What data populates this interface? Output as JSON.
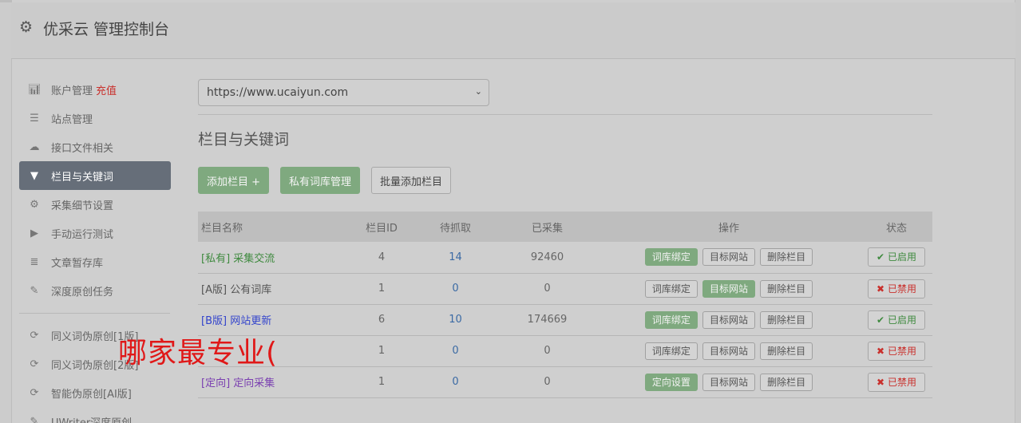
{
  "header": {
    "title": "优采云 管理控制台"
  },
  "sidebar": {
    "items": [
      {
        "label": "账户管理",
        "extra": "充值"
      },
      {
        "label": "站点管理"
      },
      {
        "label": "接口文件相关"
      },
      {
        "label": "栏目与关键词"
      },
      {
        "label": "采集细节设置"
      },
      {
        "label": "手动运行测试"
      },
      {
        "label": "文章暂存库"
      },
      {
        "label": "深度原创任务"
      }
    ],
    "items2": [
      {
        "label": "同义词伪原创[1版]"
      },
      {
        "label": "同义词伪原创[2版]"
      },
      {
        "label": "智能伪原创[AI版]"
      },
      {
        "label": "UWriter深度原创"
      }
    ]
  },
  "site_select": {
    "value": "https://www.ucaiyun.com"
  },
  "page_title": "栏目与关键词",
  "toolbar": {
    "add_label": "添加栏目 +",
    "private_label": "私有词库管理",
    "batch_label": "批量添加栏目"
  },
  "table": {
    "headers": [
      "栏目名称",
      "栏目ID",
      "待抓取",
      "已采集",
      "操作",
      "状态"
    ],
    "rows": [
      {
        "tag": "[私有]",
        "name": "采集交流",
        "id": "4",
        "wait": "14",
        "got": "92460",
        "op1": "词库绑定",
        "op2": "目标网站",
        "op3": "删除栏目",
        "status": "已启用"
      },
      {
        "tag": "[A版]",
        "name": "公有词库",
        "id": "1",
        "wait": "0",
        "got": "0",
        "op1": "词库绑定",
        "op2": "目标网站",
        "op3": "删除栏目",
        "status": "已禁用"
      },
      {
        "tag": "[B版]",
        "name": "网站更新",
        "id": "6",
        "wait": "10",
        "got": "174669",
        "op1": "词库绑定",
        "op2": "目标网站",
        "op3": "删除栏目",
        "status": "已启用"
      },
      {
        "tag": "",
        "name": "",
        "id": "1",
        "wait": "0",
        "got": "0",
        "op1": "词库绑定",
        "op2": "目标网站",
        "op3": "删除栏目",
        "status": "已禁用"
      },
      {
        "tag": "[定向]",
        "name": "定向采集",
        "id": "1",
        "wait": "0",
        "got": "0",
        "op1": "定向设置",
        "op2": "目标网站",
        "op3": "删除栏目",
        "status": "已禁用"
      }
    ]
  },
  "overlay_text": "哪家最专业(",
  "colors": {
    "green": "#7fa97f",
    "active_nav": "#666e79",
    "red": "#c9302c",
    "blue": "#3b6aa4"
  }
}
